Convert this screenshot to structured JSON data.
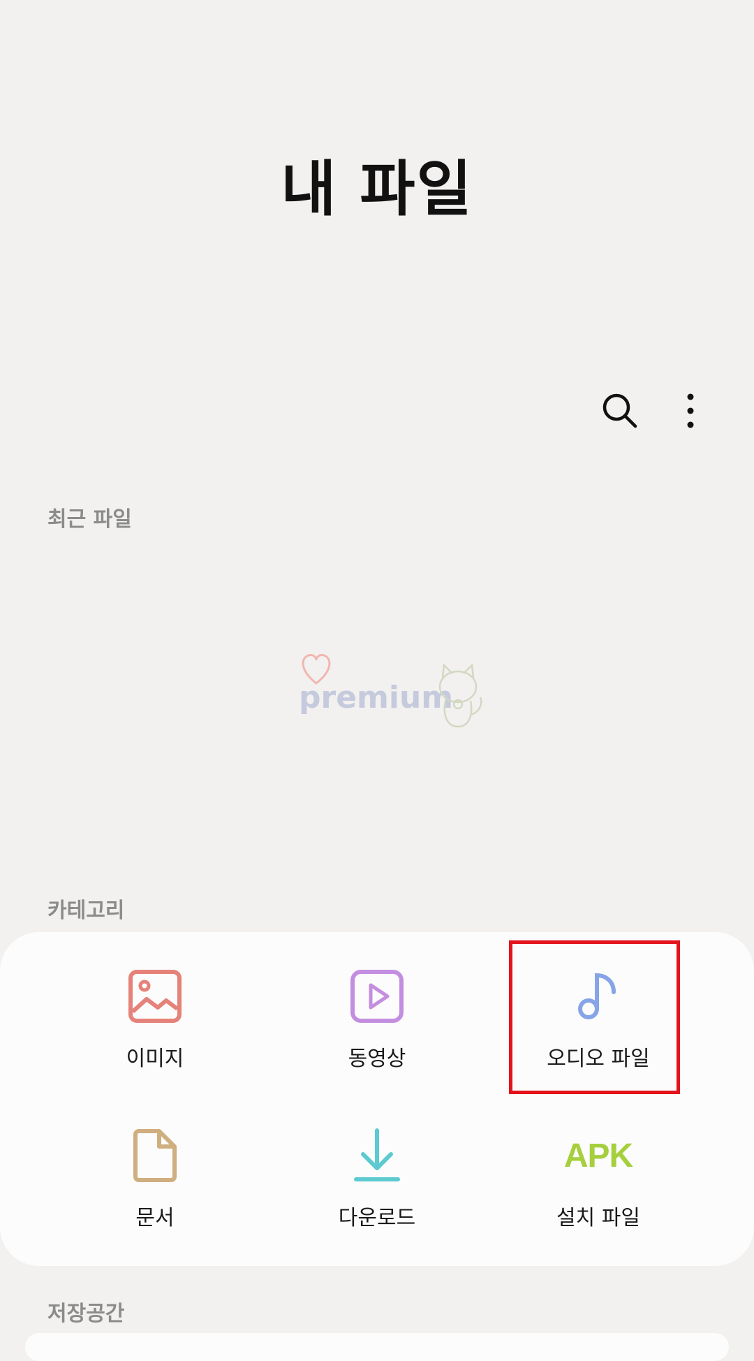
{
  "app": {
    "title": "내 파일"
  },
  "toolbar": {
    "search_icon": "search-icon",
    "more_icon": "more-vertical-icon"
  },
  "sections": {
    "recent": "최근 파일",
    "category": "카테고리",
    "storage": "저장공간"
  },
  "watermark": {
    "text": "premium"
  },
  "categories": [
    {
      "label": "이미지",
      "icon": "image-icon",
      "color": "#e5827a"
    },
    {
      "label": "동영상",
      "icon": "video-icon",
      "color": "#c48ee0"
    },
    {
      "label": "오디오 파일",
      "icon": "music-note-icon",
      "color": "#86a4e6"
    },
    {
      "label": "문서",
      "icon": "document-icon",
      "color": "#cfae7f"
    },
    {
      "label": "다운로드",
      "icon": "download-icon",
      "color": "#5ccad0"
    },
    {
      "label": "설치 파일",
      "icon": "apk-icon",
      "color": "#a6cf3e",
      "icon_text": "APK"
    }
  ],
  "highlight": {
    "target": "오디오 파일",
    "color": "#e3141b"
  }
}
